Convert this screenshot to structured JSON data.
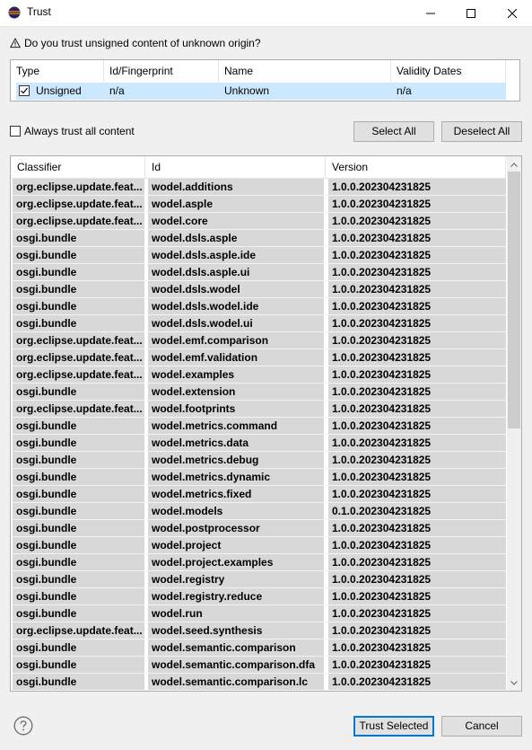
{
  "window": {
    "title": "Trust"
  },
  "question": "Do you trust unsigned content of unknown origin?",
  "signers": {
    "columns": [
      "Type",
      "Id/Fingerprint",
      "Name",
      "Validity Dates"
    ],
    "rows": [
      {
        "checked": true,
        "type": "Unsigned",
        "id": "n/a",
        "name": "Unknown",
        "validity": "n/a"
      }
    ]
  },
  "always_trust_label": "Always trust all content",
  "buttons": {
    "select_all": "Select All",
    "deselect_all": "Deselect All",
    "trust_selected": "Trust Selected",
    "cancel": "Cancel"
  },
  "content": {
    "columns": [
      "Classifier",
      "Id",
      "Version"
    ],
    "rows": [
      [
        "org.eclipse.update.feat...",
        "wodel.additions",
        "1.0.0.202304231825"
      ],
      [
        "org.eclipse.update.feat...",
        "wodel.asple",
        "1.0.0.202304231825"
      ],
      [
        "org.eclipse.update.feat...",
        "wodel.core",
        "1.0.0.202304231825"
      ],
      [
        "osgi.bundle",
        "wodel.dsls.asple",
        "1.0.0.202304231825"
      ],
      [
        "osgi.bundle",
        "wodel.dsls.asple.ide",
        "1.0.0.202304231825"
      ],
      [
        "osgi.bundle",
        "wodel.dsls.asple.ui",
        "1.0.0.202304231825"
      ],
      [
        "osgi.bundle",
        "wodel.dsls.wodel",
        "1.0.0.202304231825"
      ],
      [
        "osgi.bundle",
        "wodel.dsls.wodel.ide",
        "1.0.0.202304231825"
      ],
      [
        "osgi.bundle",
        "wodel.dsls.wodel.ui",
        "1.0.0.202304231825"
      ],
      [
        "org.eclipse.update.feat...",
        "wodel.emf.comparison",
        "1.0.0.202304231825"
      ],
      [
        "org.eclipse.update.feat...",
        "wodel.emf.validation",
        "1.0.0.202304231825"
      ],
      [
        "org.eclipse.update.feat...",
        "wodel.examples",
        "1.0.0.202304231825"
      ],
      [
        "osgi.bundle",
        "wodel.extension",
        "1.0.0.202304231825"
      ],
      [
        "org.eclipse.update.feat...",
        "wodel.footprints",
        "1.0.0.202304231825"
      ],
      [
        "osgi.bundle",
        "wodel.metrics.command",
        "1.0.0.202304231825"
      ],
      [
        "osgi.bundle",
        "wodel.metrics.data",
        "1.0.0.202304231825"
      ],
      [
        "osgi.bundle",
        "wodel.metrics.debug",
        "1.0.0.202304231825"
      ],
      [
        "osgi.bundle",
        "wodel.metrics.dynamic",
        "1.0.0.202304231825"
      ],
      [
        "osgi.bundle",
        "wodel.metrics.fixed",
        "1.0.0.202304231825"
      ],
      [
        "osgi.bundle",
        "wodel.models",
        "0.1.0.202304231825"
      ],
      [
        "osgi.bundle",
        "wodel.postprocessor",
        "1.0.0.202304231825"
      ],
      [
        "osgi.bundle",
        "wodel.project",
        "1.0.0.202304231825"
      ],
      [
        "osgi.bundle",
        "wodel.project.examples",
        "1.0.0.202304231825"
      ],
      [
        "osgi.bundle",
        "wodel.registry",
        "1.0.0.202304231825"
      ],
      [
        "osgi.bundle",
        "wodel.registry.reduce",
        "1.0.0.202304231825"
      ],
      [
        "osgi.bundle",
        "wodel.run",
        "1.0.0.202304231825"
      ],
      [
        "org.eclipse.update.feat...",
        "wodel.seed.synthesis",
        "1.0.0.202304231825"
      ],
      [
        "osgi.bundle",
        "wodel.semantic.comparison",
        "1.0.0.202304231825"
      ],
      [
        "osgi.bundle",
        "wodel.semantic.comparison.dfa",
        "1.0.0.202304231825"
      ],
      [
        "osgi.bundle",
        "wodel.semantic.comparison.lc",
        "1.0.0.202304231825"
      ]
    ]
  },
  "icons": {
    "app": "eclipse-icon",
    "warning": "warning-icon",
    "minimize": "minimize-icon",
    "maximize": "maximize-icon",
    "close": "close-icon",
    "help": "help-icon",
    "scroll_up": "scroll-up-icon",
    "scroll_down": "scroll-down-icon"
  },
  "colors": {
    "selection": "#cce8ff",
    "row_bg": "#d8d8d8",
    "default_button_border": "#0078d7"
  }
}
